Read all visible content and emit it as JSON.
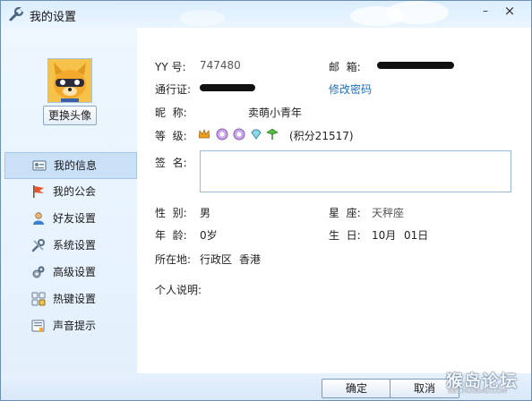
{
  "window": {
    "title": "我的设置",
    "minimize": "–",
    "close": "×"
  },
  "sidebar": {
    "change_avatar_label": "更换头像",
    "items": [
      {
        "label": "我的信息",
        "icon": "id-card-icon"
      },
      {
        "label": "我的公会",
        "icon": "flag-icon"
      },
      {
        "label": "好友设置",
        "icon": "friend-icon"
      },
      {
        "label": "系统设置",
        "icon": "tools-icon"
      },
      {
        "label": "高级设置",
        "icon": "advanced-gear-icon"
      },
      {
        "label": "热键设置",
        "icon": "hotkey-icon"
      },
      {
        "label": "声音提示",
        "icon": "sound-icon"
      }
    ],
    "active_index": 0
  },
  "profile": {
    "yy_label": "YY 号:",
    "yy_value": "747480",
    "email_label": "邮  箱:",
    "pass_label": "通行证:",
    "change_password": "修改密码",
    "nickname_label": "昵  称:",
    "nickname_value": "卖萌小青年",
    "level_label": "等  级:",
    "level_points": "(积分21517)",
    "signature_label": "签  名:",
    "gender_label": "性  别:",
    "gender_value": "男",
    "zodiac_label": "星  座:",
    "zodiac_value": "天秤座",
    "age_label": "年  龄:",
    "age_value": "0岁",
    "birthday_label": "生  日:",
    "birthday_month": "10月",
    "birthday_day": "01日",
    "location_label": "所在地:",
    "location_region": "行政区",
    "location_city": "香港",
    "about_label": "个人说明:"
  },
  "footer": {
    "ok_label": "确定",
    "cancel_label": "取消"
  },
  "watermark": {
    "text": "猴岛论坛",
    "sub": "BBS.HOUDAO.COM"
  },
  "colors": {
    "accent": "#1e6fc0",
    "sidebar_active": "#c9e0f7"
  }
}
